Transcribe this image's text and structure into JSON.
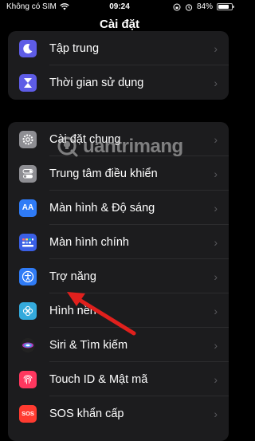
{
  "status_bar": {
    "carrier": "Không có SIM",
    "time": "09:24",
    "battery_percent": "84%",
    "battery_level": 0.84,
    "wifi_icon": "wifi-icon",
    "alarm_icon": "alarm-icon"
  },
  "nav": {
    "title": "Cài đặt"
  },
  "group1": [
    {
      "label": "Tập trung",
      "icon": "moon-icon",
      "color": "#5e5ce6"
    },
    {
      "label": "Thời gian sử dụng",
      "icon": "hourglass-icon",
      "color": "#5e5ce6"
    }
  ],
  "group2": [
    {
      "label": "Cài đặt chung",
      "icon": "gear-icon",
      "color": "#8e8e93"
    },
    {
      "label": "Trung tâm điều khiển",
      "icon": "toggle-icon",
      "color": "#8e8e93"
    },
    {
      "label": "Màn hình & Độ sáng",
      "icon": "aa-icon",
      "glyph": "AA",
      "color": "#2f7bf6"
    },
    {
      "label": "Màn hình chính",
      "icon": "home-grid-icon",
      "color": "#3a5fe5"
    },
    {
      "label": "Trợ năng",
      "icon": "accessibility-icon",
      "color": "#2f7bf6"
    },
    {
      "label": "Hình nền",
      "icon": "wallpaper-icon",
      "color": "#34aadc"
    },
    {
      "label": "Siri & Tìm kiếm",
      "icon": "siri-icon",
      "color": "#1c1c1e"
    },
    {
      "label": "Touch ID & Mật mã",
      "icon": "fingerprint-icon",
      "color": "#ff375f"
    },
    {
      "label": "SOS khẩn cấp",
      "icon": "sos-icon",
      "glyph": "SOS",
      "color": "#ff3b30"
    }
  ],
  "watermark": {
    "text": "uantrimang",
    "icon": "quantrimang-logo-icon"
  },
  "chevron": "›",
  "arrow_color": "#e0201d"
}
